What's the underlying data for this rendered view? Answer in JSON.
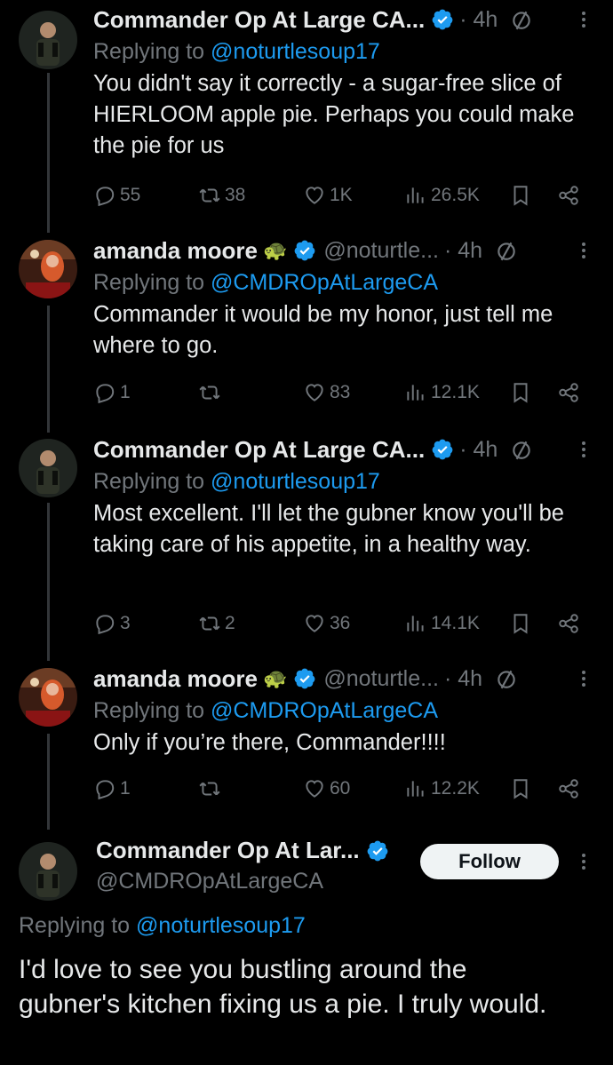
{
  "tweets": [
    {
      "name": "Commander Op At Large CA...",
      "emoji": "",
      "handle": "",
      "time": "· 4h",
      "replying_prefix": "Replying to ",
      "replying_handle": "@noturtlesoup17",
      "text": "You didn't say it correctly - a sugar-free slice of HIERLOOM apple pie.  Perhaps you could make the pie for us",
      "replies": "55",
      "retweets": "38",
      "likes": "1K",
      "views": "26.5K"
    },
    {
      "name": "amanda moore",
      "emoji": "🐢",
      "handle": "@noturtle...",
      "time": "· 4h",
      "replying_prefix": "Replying to ",
      "replying_handle": "@CMDROpAtLargeCA",
      "text": "Commander it would be my honor, just tell me where to go.",
      "replies": "1",
      "retweets": "",
      "likes": "83",
      "views": "12.1K"
    },
    {
      "name": "Commander Op At Large CA...",
      "emoji": "",
      "handle": "",
      "time": "· 4h",
      "replying_prefix": "Replying to ",
      "replying_handle": "@noturtlesoup17",
      "text": "Most excellent.   I'll let the gubner know you'll be taking care of his appetite, in a healthy way.",
      "replies": "3",
      "retweets": "2",
      "likes": "36",
      "views": "14.1K"
    },
    {
      "name": "amanda moore",
      "emoji": "🐢",
      "handle": "@noturtle...",
      "time": "· 4h",
      "replying_prefix": "Replying to ",
      "replying_handle": "@CMDROpAtLargeCA",
      "text": "Only if you’re there, Commander!!!!",
      "replies": "1",
      "retweets": "",
      "likes": "60",
      "views": "12.2K"
    }
  ],
  "main_tweet": {
    "name": "Commander Op At Lar...",
    "handle": "@CMDROpAtLargeCA",
    "follow_label": "Follow",
    "replying_prefix": "Replying to ",
    "replying_handle": "@noturtlesoup17",
    "text": "I'd love to see you bustling around the gubner's kitchen fixing us a pie.  I truly would."
  },
  "colors": {
    "background": "#000000",
    "text": "#e7e9ea",
    "muted": "#71767b",
    "accent": "#1d9bf0",
    "thread_line": "#333639"
  },
  "icons": [
    "verified-badge-icon",
    "edit-history-icon",
    "more-icon",
    "reply-icon",
    "retweet-icon",
    "like-icon",
    "views-icon",
    "bookmark-icon",
    "share-icon"
  ]
}
